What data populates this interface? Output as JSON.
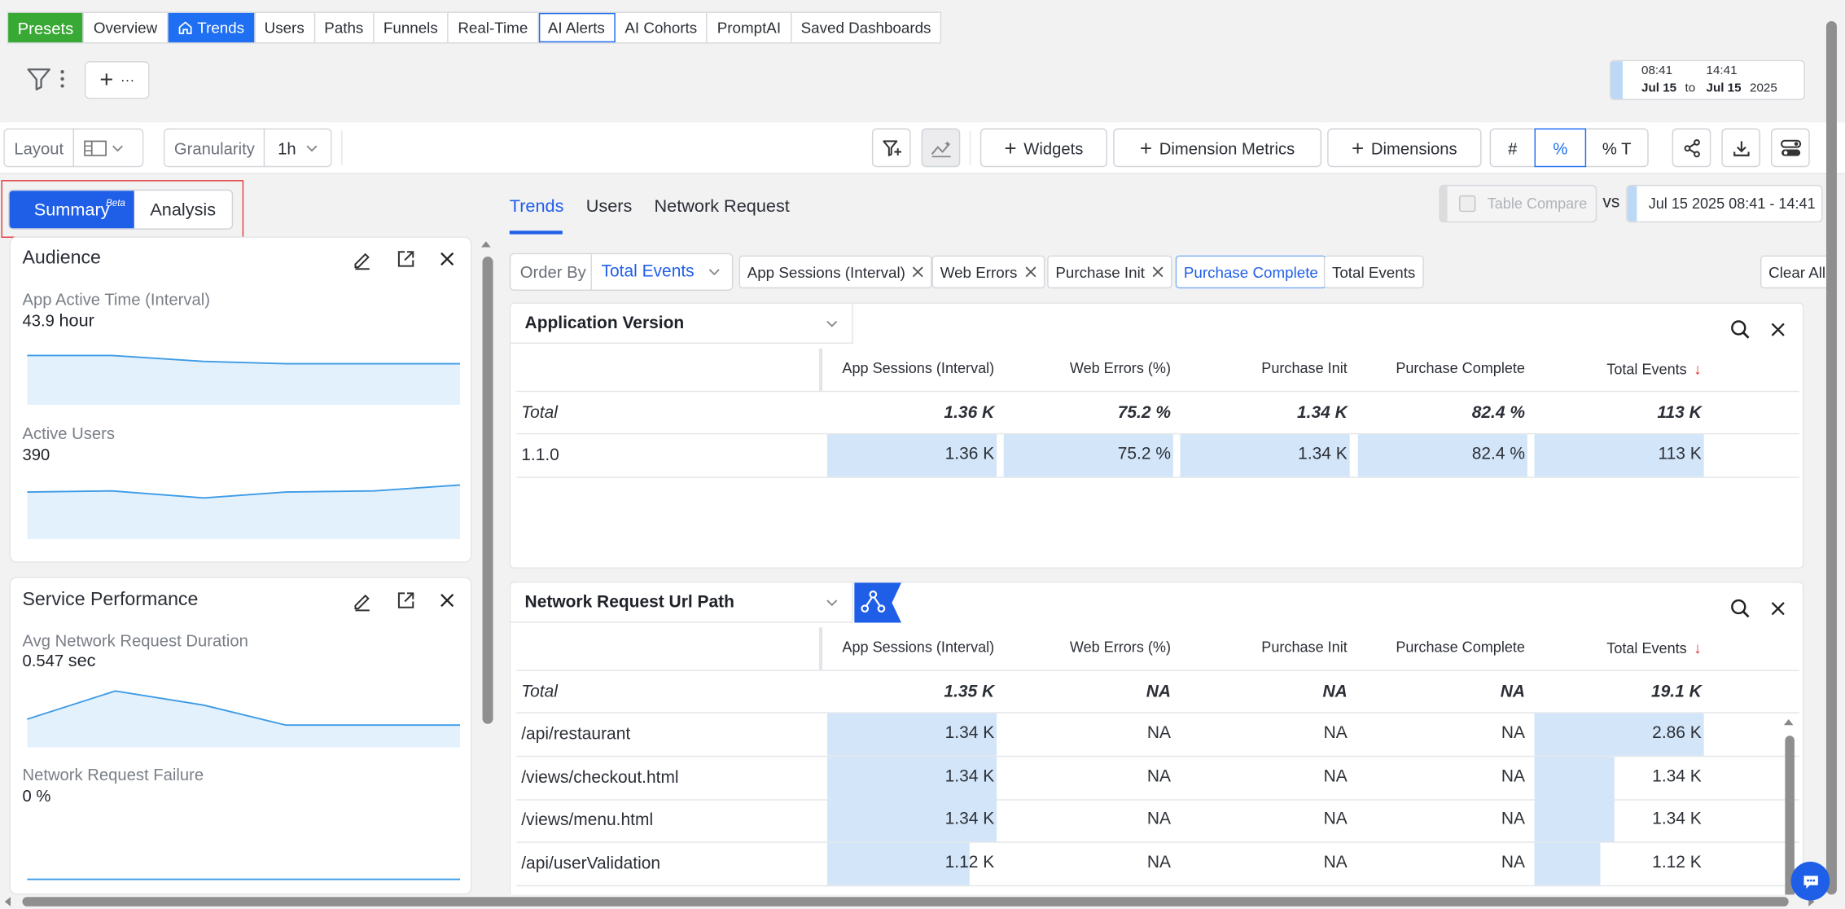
{
  "topnav": {
    "presets": "Presets",
    "tabs": [
      "Overview",
      "Trends",
      "Users",
      "Paths",
      "Funnels",
      "Real-Time",
      "AI Alerts",
      "AI Cohorts",
      "PromptAI",
      "Saved Dashboards"
    ]
  },
  "daterange": {
    "start_time": "08:41",
    "end_time": "14:41",
    "start_date": "Jul 15",
    "to": "to",
    "end_date": "Jul 15",
    "year": "2025"
  },
  "add_more": "···",
  "toolbar": {
    "layout_label": "Layout",
    "granularity_label": "Granularity",
    "granularity_value": "1h",
    "widgets": "Widgets",
    "dimension_metrics": "Dimension Metrics",
    "dimensions": "Dimensions",
    "mode_count": "#",
    "mode_percent": "%",
    "mode_percent_total": "% T"
  },
  "left": {
    "summary": "Summary",
    "beta": "Beta",
    "analysis": "Analysis",
    "audience": {
      "title": "Audience",
      "m1_label": "App Active Time (Interval)",
      "m1_value": "43.9",
      "m1_unit": "hour",
      "m2_label": "Active Users",
      "m2_value": "390"
    },
    "service": {
      "title": "Service Performance",
      "m1_label": "Avg Network Request Duration",
      "m1_value": "0.547",
      "m1_unit": "sec",
      "m2_label": "Network Request Failure",
      "m2_value": "0 %"
    }
  },
  "right": {
    "tabs": [
      "Trends",
      "Users",
      "Network Request"
    ],
    "table_compare": "Table Compare",
    "vs": "vs",
    "compare_range": "Jul 15 2025 08:41 - 14:41",
    "order_by_label": "Order By",
    "order_by_value": "Total Events",
    "chips": [
      "App Sessions (Interval)",
      "Web Errors",
      "Purchase Init",
      "Purchase Complete",
      "Total Events"
    ],
    "clear_all": "Clear All"
  },
  "columns": [
    "App Sessions (Interval)",
    "Web Errors (%)",
    "Purchase Init",
    "Purchase Complete",
    "Total Events"
  ],
  "table1": {
    "dimension": "Application Version",
    "total_label": "Total",
    "total": [
      "1.36 K",
      "75.2 %",
      "1.34 K",
      "82.4 %",
      "113 K"
    ],
    "rows": [
      {
        "name": "1.1.0",
        "values": [
          "1.36 K",
          "75.2 %",
          "1.34 K",
          "82.4 %",
          "113 K"
        ],
        "fills": [
          1,
          1,
          1,
          1,
          1
        ]
      }
    ]
  },
  "table2": {
    "dimension": "Network Request Url Path",
    "total_label": "Total",
    "total": [
      "1.35 K",
      "NA",
      "NA",
      "NA",
      "19.1 K"
    ],
    "rows": [
      {
        "name": "/api/restaurant",
        "values": [
          "1.34 K",
          "NA",
          "NA",
          "NA",
          "2.86 K"
        ],
        "fills": [
          1,
          0,
          0,
          0,
          1
        ]
      },
      {
        "name": "/views/checkout.html",
        "values": [
          "1.34 K",
          "NA",
          "NA",
          "NA",
          "1.34 K"
        ],
        "fills": [
          1,
          0,
          0,
          0,
          0.47
        ]
      },
      {
        "name": "/views/menu.html",
        "values": [
          "1.34 K",
          "NA",
          "NA",
          "NA",
          "1.34 K"
        ],
        "fills": [
          1,
          0,
          0,
          0,
          0.47
        ]
      },
      {
        "name": "/api/userValidation",
        "values": [
          "1.12 K",
          "NA",
          "NA",
          "NA",
          "1.12 K"
        ],
        "fills": [
          0.84,
          0,
          0,
          0,
          0.39
        ]
      }
    ]
  }
}
